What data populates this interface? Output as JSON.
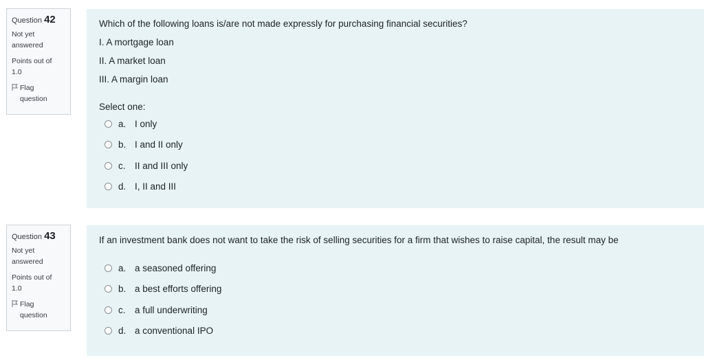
{
  "questions": [
    {
      "label": "Question",
      "number": "42",
      "status_line1": "Not yet",
      "status_line2": "answered",
      "points_line1": "Points out of",
      "points_line2": "1.0",
      "flag_line1": "Flag",
      "flag_line2": "question",
      "text": "Which of the following loans is/are not made expressly for purchasing financial securities?",
      "statements": [
        "I.  A mortgage loan",
        "II.  A market loan",
        "III.  A margin loan"
      ],
      "prompt": "Select one:",
      "options": [
        {
          "letter": "a.",
          "text": "I only"
        },
        {
          "letter": "b.",
          "text": "I and II only"
        },
        {
          "letter": "c.",
          "text": "II and III only"
        },
        {
          "letter": "d.",
          "text": "I, II and III"
        }
      ]
    },
    {
      "label": "Question",
      "number": "43",
      "status_line1": "Not yet",
      "status_line2": "answered",
      "points_line1": "Points out of",
      "points_line2": "1.0",
      "flag_line1": "Flag",
      "flag_line2": "question",
      "text": "If an investment bank does not want to take the risk of selling securities for a firm that wishes to raise capital,  the result may be",
      "options": [
        {
          "letter": "a.",
          "text": "a seasoned offering"
        },
        {
          "letter": "b.",
          "text": "a best efforts offering"
        },
        {
          "letter": "c.",
          "text": "a full underwriting"
        },
        {
          "letter": "d.",
          "text": "a conventional IPO"
        }
      ]
    }
  ]
}
